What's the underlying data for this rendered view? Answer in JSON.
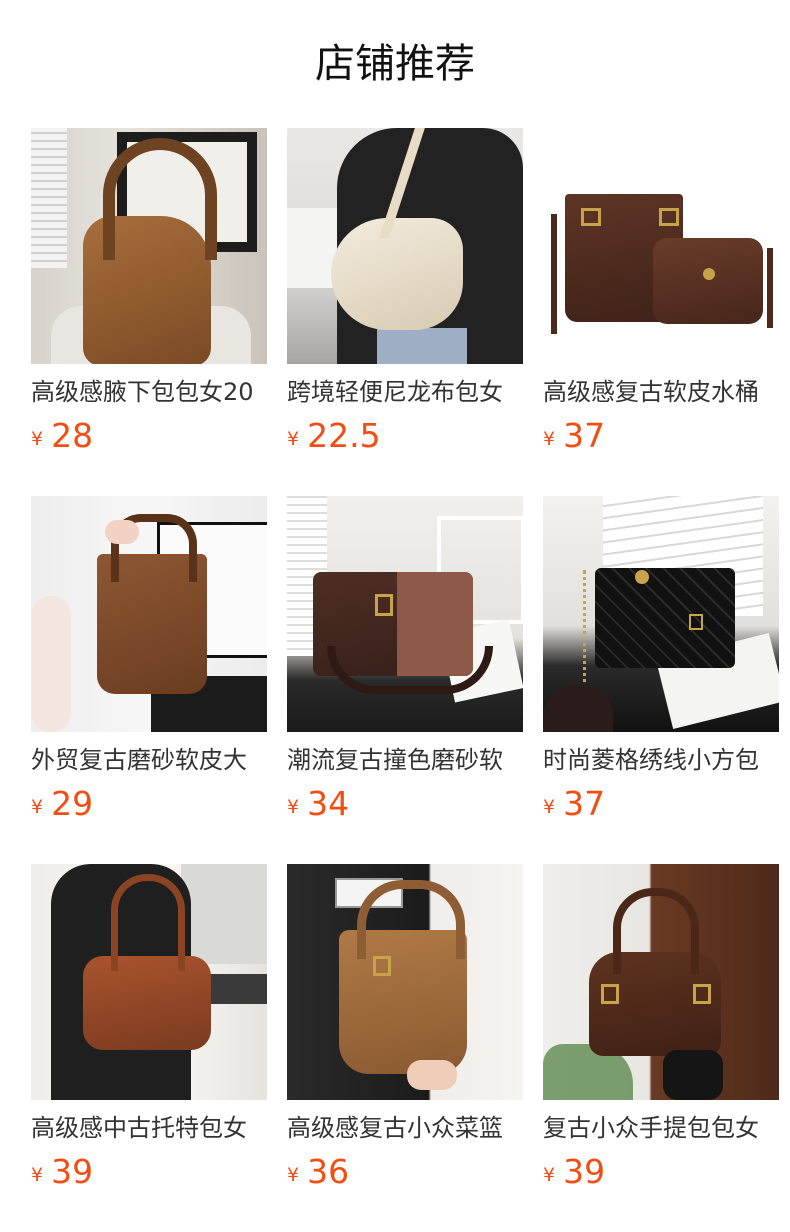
{
  "section": {
    "title": "店铺推荐"
  },
  "currency": "¥",
  "products": [
    {
      "name": "高级感腋下包包女20",
      "price": "28",
      "image": "brown-hobo-bag-photo"
    },
    {
      "name": "跨境轻便尼龙布包女",
      "price": "22.5",
      "image": "cream-nylon-shoulder-bag-photo"
    },
    {
      "name": "高级感复古软皮水桶",
      "price": "37",
      "image": "brown-bucket-bag-set-photo"
    },
    {
      "name": "外贸复古磨砂软皮大",
      "price": "29",
      "image": "suede-tote-bag-photo"
    },
    {
      "name": "潮流复古撞色磨砂软",
      "price": "34",
      "image": "colorblock-crossbody-bag-photo"
    },
    {
      "name": "时尚菱格绣线小方包",
      "price": "37",
      "image": "black-quilted-chain-bag-photo"
    },
    {
      "name": "高级感中古托特包女",
      "price": "39",
      "image": "brown-vintage-tote-photo"
    },
    {
      "name": "高级感复古小众菜篮",
      "price": "36",
      "image": "tan-basket-bag-photo"
    },
    {
      "name": "复古小众手提包包女",
      "price": "39",
      "image": "brown-boston-handbag-photo"
    }
  ]
}
